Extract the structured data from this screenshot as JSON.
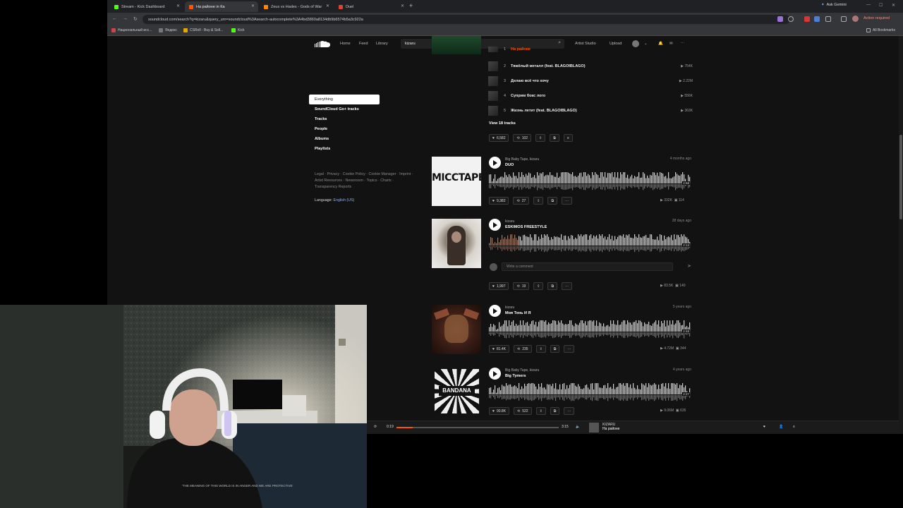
{
  "browser": {
    "tabs": [
      {
        "label": "Stream - Kick Dashboard",
        "color": "#53fc18"
      },
      {
        "label": "На районе in Кa",
        "color": "#ff5500"
      },
      {
        "label": "Zeus vs Hades - Gods of War",
        "color": "#ff8800"
      },
      {
        "label": "Duel",
        "color": "#e2432e"
      }
    ],
    "new_tab": "+",
    "ask_gemini": "Ask Gemini",
    "url": "soundcloud.com/search?q=kizaru&query_urn=soundcloud%3Asearch-autocomplete%3A4bd3860a8134db9b6574b5a3c922a",
    "action_required": "Action required",
    "bookmarks": [
      {
        "label": "Национальный исс...",
        "color": "#c44"
      },
      {
        "label": "Яндекс",
        "color": "#777"
      },
      {
        "label": "CSRoll - Buy & Sell...",
        "color": "#e8a500"
      },
      {
        "label": "Kick",
        "color": "#53fc18"
      }
    ],
    "all_bookmarks": "All Bookmarks"
  },
  "soundcloud": {
    "nav": {
      "home": "Home",
      "feed": "Feed",
      "library": "Library"
    },
    "search_value": "kizaru",
    "artist_studio": "Artist Studio",
    "upload": "Upload",
    "filters": [
      "Everything",
      "SoundCloud Go+ tracks",
      "Tracks",
      "People",
      "Albums",
      "Playlists"
    ],
    "footer_links": "Legal · Privacy · Cookie Policy · Cookie Manager · Imprint · Artist Resources · Newsroom · Topics · Charts · Transparency Reports",
    "language_label": "Language:",
    "language_value": "English (US)",
    "top_partial_title": "На районе",
    "playlist_tracks": [
      {
        "num": "2",
        "title": "Тяжёлый металл (feat. BLAGOIBLAGO)",
        "plays": "754K"
      },
      {
        "num": "3",
        "title": "Делаю всё что хочу",
        "plays": "2.22M"
      },
      {
        "num": "4",
        "title": "Суприм бокс лого",
        "plays": "556K"
      },
      {
        "num": "5",
        "title": "Жизнь летит (feat. BLAGOIBLAGO)",
        "plays": "363K"
      }
    ],
    "view_tracks": "View 18 tracks",
    "playlist_actions": {
      "likes": "6,582",
      "reposts": "102"
    },
    "tracks": [
      {
        "artist": "Big Baby Tape, kizaru",
        "title": "DUO",
        "posted": "4 months ago",
        "cover_text": "MICCTAPE",
        "likes": "9,382",
        "reposts": "27",
        "plays": "332K",
        "comments": "114",
        "duration": "2:58",
        "progress": 0
      },
      {
        "artist": "kizaru",
        "title": "ESKIMOS FREESTYLE",
        "posted": "28 days ago",
        "likes": "1,997",
        "reposts": "19",
        "plays": "83.5K",
        "comments": "140",
        "duration": "2:13",
        "progress": 0.14
      },
      {
        "artist": "kizaru",
        "title": "Моя Тень И Я",
        "posted": "5 years ago",
        "likes": "81.4K",
        "reposts": "235",
        "plays": "4.72M",
        "comments": "344",
        "duration": "2:48",
        "progress": 0
      },
      {
        "artist": "Big Baby Tape, kizaru",
        "title": "Big Tymers",
        "posted": "4 years ago",
        "cover_text": "BANDANA",
        "likes": "90.8K",
        "reposts": "522",
        "plays": "9.06M",
        "comments": "635",
        "duration": "2:27",
        "progress": 0
      }
    ],
    "comment_placeholder": "Write a comment",
    "player": {
      "elapsed": "0:19",
      "total": "3:15",
      "progress": 0.1,
      "np_artist": "KIZARU",
      "np_title": "На районе"
    }
  },
  "webcam": {
    "shirt_text": "'THE MEANING OF THIS WORLD IS IN ANGER AND WE ARE PROTECTIVE'"
  }
}
